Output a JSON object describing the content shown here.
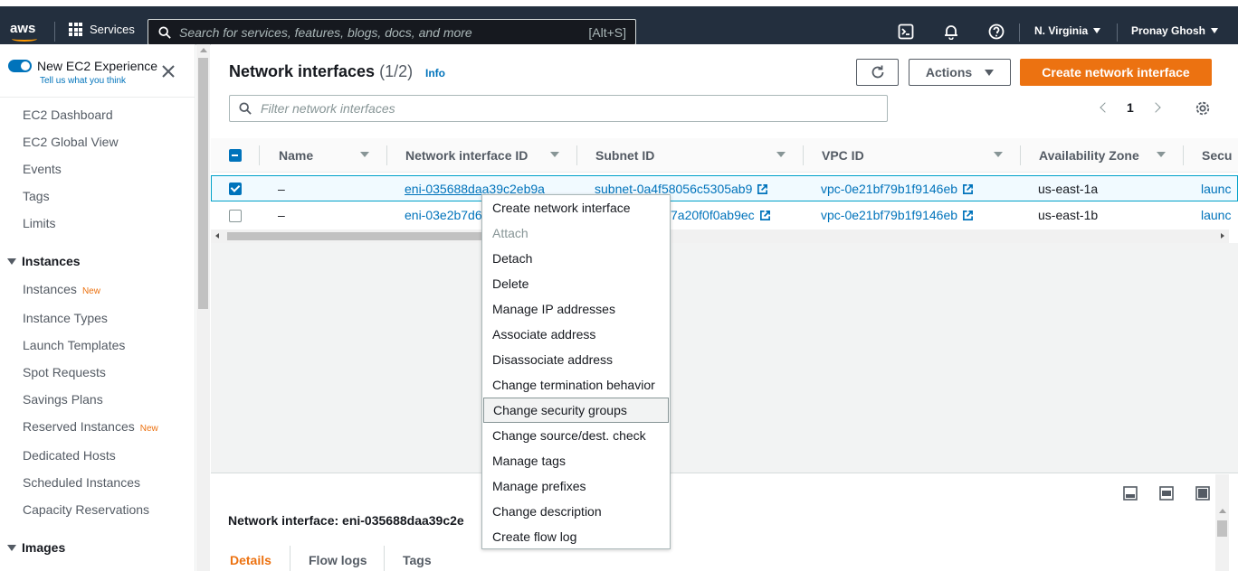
{
  "topnav": {
    "logo_text": "aws",
    "services_label": "Services",
    "search_placeholder": "Search for services, features, blogs, docs, and more",
    "search_shortcut": "[Alt+S]",
    "region": "N. Virginia",
    "user": "Pronay Ghosh"
  },
  "sidebar": {
    "toggle_label": "New EC2 Experience",
    "toggle_sub": "Tell us what you think",
    "items_top": [
      "EC2 Dashboard",
      "EC2 Global View",
      "Events",
      "Tags",
      "Limits"
    ],
    "section_instances": "Instances",
    "instances_items": [
      {
        "label": "Instances",
        "badge": "New"
      },
      {
        "label": "Instance Types",
        "badge": ""
      },
      {
        "label": "Launch Templates",
        "badge": ""
      },
      {
        "label": "Spot Requests",
        "badge": ""
      },
      {
        "label": "Savings Plans",
        "badge": ""
      },
      {
        "label": "Reserved Instances",
        "badge": "New"
      },
      {
        "label": "Dedicated Hosts",
        "badge": ""
      },
      {
        "label": "Scheduled Instances",
        "badge": ""
      },
      {
        "label": "Capacity Reservations",
        "badge": ""
      }
    ],
    "section_images": "Images"
  },
  "main": {
    "title": "Network interfaces",
    "count": "(1/2)",
    "info": "Info",
    "actions_label": "Actions",
    "create_label": "Create network interface",
    "filter_placeholder": "Filter network interfaces",
    "page": "1",
    "columns": [
      "Name",
      "Network interface ID",
      "Subnet ID",
      "VPC ID",
      "Availability Zone",
      "Secu"
    ],
    "rows": [
      {
        "name": "–",
        "eni": "eni-035688daa39c2eb9a",
        "subnet": "subnet-0a4f58056c5305ab9",
        "vpc": "vpc-0e21bf79b1f9146eb",
        "az": "us-east-1a",
        "sec": "launc",
        "selected": true
      },
      {
        "name": "–",
        "eni": "eni-03e2b7d6",
        "subnet": "7a20f0f0ab9ec",
        "vpc": "vpc-0e21bf79b1f9146eb",
        "az": "us-east-1b",
        "sec": "launc",
        "selected": false
      }
    ]
  },
  "split": {
    "title": "Network interface: eni-035688daa39c2e",
    "tabs": [
      "Details",
      "Flow logs",
      "Tags"
    ]
  },
  "menu": {
    "items": [
      "Create network interface",
      "Attach",
      "Detach",
      "Delete",
      "Manage IP addresses",
      "Associate address",
      "Disassociate address",
      "Change termination behavior",
      "Change security groups",
      "Change source/dest. check",
      "Manage tags",
      "Manage prefixes",
      "Change description",
      "Create flow log"
    ],
    "disabled_index": 1,
    "hover_index": 8
  },
  "colors": {
    "nav_bg": "#232f3e",
    "accent_orange": "#ec7211",
    "link_blue": "#0073bb"
  }
}
